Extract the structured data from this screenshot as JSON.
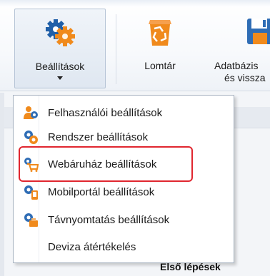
{
  "ribbon": {
    "buttons": [
      {
        "label": "Beállítások",
        "icon": "gear-orange-icon",
        "active": true,
        "has_dropdown": true
      },
      {
        "label": "Lomtár",
        "icon": "recycle-bin-icon"
      },
      {
        "label": "Adatbázis",
        "label_line2": "és vissza",
        "icon": "database-save-icon"
      }
    ]
  },
  "menu": {
    "items": [
      {
        "label": "Felhasználói beállítások",
        "icon": "users-gear-icon"
      },
      {
        "label": "Rendszer beállítások",
        "icon": "system-gear-icon"
      },
      {
        "label": "Webáruház beállítások",
        "icon": "webshop-cart-icon",
        "highlighted": true
      },
      {
        "label": "Mobilportál beállítások",
        "icon": "mobile-portal-icon"
      },
      {
        "label": "Távnyomtatás beállítások",
        "icon": "remote-print-icon"
      },
      {
        "label": "Deviza átértékelés",
        "icon": ""
      }
    ]
  },
  "background": {
    "first_steps": "Első lépések"
  },
  "colors": {
    "highlight": "#e0262f",
    "accent_orange": "#f08a1c",
    "accent_blue": "#2f6db5"
  }
}
